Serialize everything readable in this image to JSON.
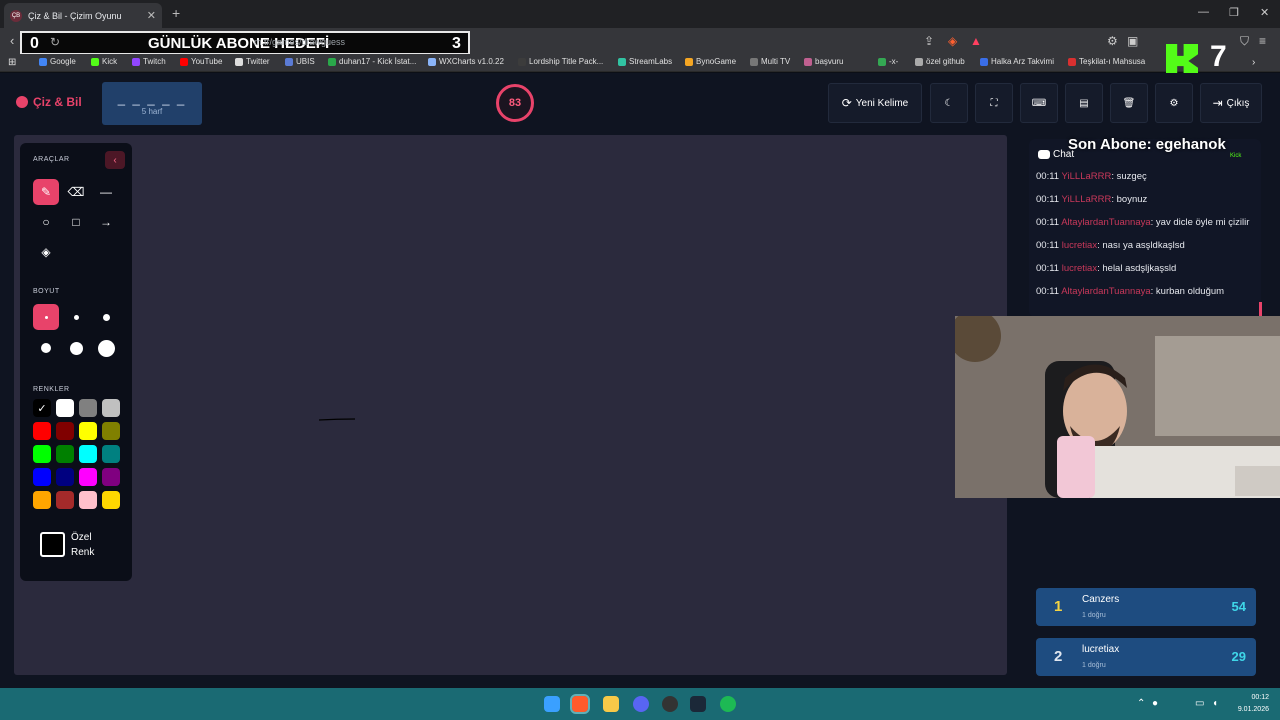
{
  "browser": {
    "tab_title": "Çiz & Bil - Çizim Oyunu",
    "tab_favicon": "ÇB",
    "url": "m.tr/games/drawguess",
    "bookmarks": [
      "Google",
      "Kick",
      "Twitch",
      "YouTube",
      "Twitter",
      "UBIS",
      "duhan17 - Kick İstat...",
      "WXCharts v1.0.22",
      "Lordship Title Pack...",
      "StreamLabs",
      "BynoGame",
      "Multi TV",
      "başvuru",
      "-x-",
      "özel github",
      "Halka Arz Takvimi",
      "Teşkilat-ı Mahsusa"
    ],
    "bookmark_colors": [
      "#4285f4",
      "#53fc18",
      "#9146ff",
      "#ff0000",
      "#dddddd",
      "#5b7bd5",
      "#2aa84a",
      "#8ab4f8",
      "#3c3c3c",
      "#31c3a2",
      "#f5a623",
      "#777777",
      "#c06090",
      "#34a853",
      "#aaaaaa",
      "#3a6ee8",
      "#d93030"
    ]
  },
  "stream_overlay": {
    "goal_left": "0",
    "goal_title": "GÜNLÜK ABONE HEDEFİ",
    "goal_right": "3",
    "kick_count": "7",
    "last_sub": "Son Abone: egehanok",
    "kick_chip": "Kick"
  },
  "header": {
    "brand": "Çiz & Bil",
    "word_blanks": "_ _ _ _ _",
    "word_length": "5 harf",
    "timer": "83",
    "new_word": "Yeni Kelime"
  },
  "tools_panel": {
    "tools_label": "ARAÇLAR",
    "size_label": "BOYUT",
    "colors_label": "RENKLER",
    "custom_color_label": "Özel Renk",
    "colors": [
      "#000000",
      "#ffffff",
      "#808080",
      "#c0c0c0",
      "#ff0000",
      "#800000",
      "#ffff00",
      "#808000",
      "#00ff00",
      "#008000",
      "#00ffff",
      "#008080",
      "#0000ff",
      "#000080",
      "#ff00ff",
      "#800080",
      "#ffa500",
      "#a52a2a",
      "#ffc0cb",
      "#ffd700"
    ]
  },
  "chat": {
    "title": "Chat",
    "messages": [
      {
        "time": "00:11",
        "user": "YiLLLaRRR",
        "text": ": suzgeç"
      },
      {
        "time": "00:11",
        "user": "YiLLLaRRR",
        "text": ": boynuz"
      },
      {
        "time": "00:11",
        "user": "AltaylardanTuannaya",
        "text": ": yav dicle öyle mi çizilir"
      },
      {
        "time": "00:11",
        "user": "lucretiax",
        "text": ": nası ya asşldkaşlsd"
      },
      {
        "time": "00:11",
        "user": "lucretiax",
        "text": ": helal asdşljkaşsld"
      },
      {
        "time": "00:11",
        "user": "AltaylardanTuannaya",
        "text": ": kurban olduğum"
      }
    ]
  },
  "leaderboard": [
    {
      "rank": "1",
      "name": "Canzers",
      "sub": "1 doğru",
      "score": "54",
      "rank_color": "#f5d442"
    },
    {
      "rank": "2",
      "name": "lucretiax",
      "sub": "1 doğru",
      "score": "29",
      "rank_color": "#e0e6ef"
    }
  ],
  "taskbar": {
    "time": "00:12",
    "date": "9.01.2026"
  },
  "colors": {
    "accent": "#e8436a",
    "canvas": "#2b2a3d",
    "app_bg": "#0f1421",
    "leaderboard_row": "#1e4c80"
  }
}
